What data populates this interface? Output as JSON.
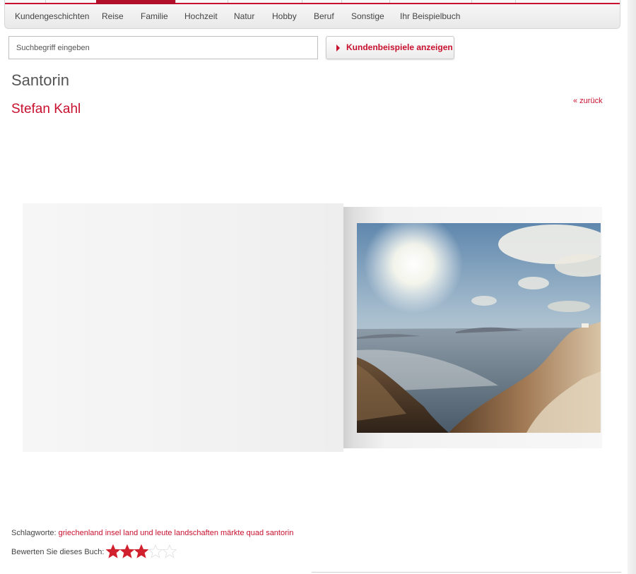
{
  "nav": {
    "items": [
      {
        "label": "Kundengeschichten"
      },
      {
        "label": "Reise"
      },
      {
        "label": "Familie"
      },
      {
        "label": "Hochzeit"
      },
      {
        "label": "Natur"
      },
      {
        "label": "Hobby"
      },
      {
        "label": "Beruf"
      },
      {
        "label": "Sonstige"
      },
      {
        "label": "Ihr Beispielbuch"
      }
    ],
    "accent_color": "#c8102e"
  },
  "search": {
    "placeholder": "Suchbegriff eingeben",
    "value": "",
    "button_label": "Kundenbeispiele anzeigen"
  },
  "page": {
    "title": "Santorin",
    "author": "Stefan Kahl",
    "back_link": "« zurück"
  },
  "book": {
    "photo_icon": "landscape-photo"
  },
  "tags": {
    "label": "Schlagworte:",
    "value": "griechenland insel land und leute landschaften märkte quad santorin"
  },
  "rating": {
    "label": "Bewerten Sie dieses Buch:",
    "value": 3,
    "max": 5,
    "filled_color": "#d0202e",
    "empty_color": "#e4e4e4"
  }
}
